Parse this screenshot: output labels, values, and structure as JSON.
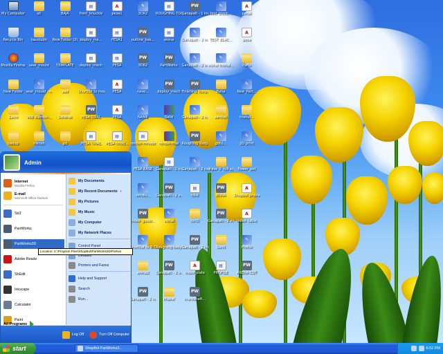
{
  "desktop": {
    "icons": [
      {
        "label": "My Computer",
        "kind": "pc",
        "glyph": ""
      },
      {
        "label": "stl",
        "kind": "folder",
        "glyph": ""
      },
      {
        "label": "BAJA",
        "kind": "folder",
        "glyph": ""
      },
      {
        "label": "front_knuckle",
        "kind": "doc",
        "glyph": "▤"
      },
      {
        "label": "pesa1",
        "kind": "pdf",
        "glyph": "A"
      },
      {
        "label": "3DR2",
        "kind": "app",
        "glyph": "✎"
      },
      {
        "label": "ROUGHING TOOLPAT...",
        "kind": "doc",
        "glyph": "▤"
      },
      {
        "label": "Ganapati - 1 inch - Top - 7",
        "kind": "pw",
        "glyph": "PW"
      },
      {
        "label": "test_block...",
        "kind": "app",
        "glyph": "✎"
      },
      {
        "label": "pesal",
        "kind": "pdf",
        "glyph": "A"
      },
      {
        "label": "Recycle Bin",
        "kind": "bin",
        "glyph": ""
      },
      {
        "label": "kaustubh",
        "kind": "folder",
        "glyph": ""
      },
      {
        "label": "New Folder (2)",
        "kind": "folder",
        "glyph": ""
      },
      {
        "label": "deploy_me...",
        "kind": "doc",
        "glyph": "▤"
      },
      {
        "label": "PESA1",
        "kind": "doc",
        "glyph": "▤"
      },
      {
        "label": "outline_bas...",
        "kind": "pw",
        "glyph": "PW"
      },
      {
        "label": "arena",
        "kind": "doc",
        "glyph": "▤"
      },
      {
        "label": "Ganapati - 2 inch - Top - 5",
        "kind": "app",
        "glyph": "✎"
      },
      {
        "label": "TEST_BLAC...",
        "kind": "app",
        "glyph": "✎"
      },
      {
        "label": "pesa",
        "kind": "pdf",
        "glyph": "A"
      },
      {
        "label": "Mozilla Firefox",
        "kind": "ff",
        "glyph": ""
      },
      {
        "label": "seat_mould",
        "kind": "folder",
        "glyph": ""
      },
      {
        "label": "TEMPLATE",
        "kind": "folder",
        "glyph": ""
      },
      {
        "label": "deploy_mech",
        "kind": "doc",
        "glyph": "▤"
      },
      {
        "label": "PESA",
        "kind": "doc",
        "glyph": "▤"
      },
      {
        "label": "3DR2",
        "kind": "pw",
        "glyph": "PW"
      },
      {
        "label": "PartWorks",
        "kind": "pw",
        "glyph": "PW"
      },
      {
        "label": "Ganapati - 2 inch - Top - 8",
        "kind": "app",
        "glyph": "✎"
      },
      {
        "label": "vishal trishul...",
        "kind": "app",
        "glyph": "✎"
      },
      {
        "label": "Parts",
        "kind": "folder",
        "glyph": ""
      },
      {
        "label": "New Folder",
        "kind": "folder",
        "glyph": ""
      },
      {
        "label": "seat_mould - new",
        "kind": "app",
        "glyph": "✎"
      },
      {
        "label": "aad",
        "kind": "folder",
        "glyph": ""
      },
      {
        "label": "Shortcut to moodcutting",
        "kind": "app",
        "glyph": "✎"
      },
      {
        "label": "PESA",
        "kind": "pdf",
        "glyph": "A"
      },
      {
        "label": "nave...",
        "kind": "app",
        "glyph": "✎"
      },
      {
        "label": "deploy_mech",
        "kind": "pw",
        "glyph": "PW"
      },
      {
        "label": "Finishing Toolpat...",
        "kind": "pw",
        "glyph": "PW"
      },
      {
        "label": "Baha",
        "kind": "folder",
        "glyph": ""
      },
      {
        "label": "New_Part...",
        "kind": "app",
        "glyph": "✎"
      },
      {
        "label": "Sachi",
        "kind": "folder",
        "glyph": ""
      },
      {
        "label": "VAB Warnish...",
        "kind": "folder",
        "glyph": ""
      },
      {
        "label": "Solidrak",
        "kind": "folder",
        "glyph": ""
      },
      {
        "label": "PESA TRIAL",
        "kind": "pw",
        "glyph": "PW"
      },
      {
        "label": "PESA",
        "kind": "pdf",
        "glyph": "A"
      },
      {
        "label": "NAME",
        "kind": "app",
        "glyph": "✎"
      },
      {
        "label": "Solid",
        "kind": "rar",
        "glyph": ""
      },
      {
        "label": "Ganapati - 2 inch32",
        "kind": "app",
        "glyph": "✎"
      },
      {
        "label": "sarchet",
        "kind": "folder",
        "glyph": ""
      },
      {
        "label": "trishul...",
        "kind": "folder",
        "glyph": ""
      },
      {
        "label": "badup",
        "kind": "folder",
        "glyph": ""
      },
      {
        "label": "nikhsh",
        "kind": "folder",
        "glyph": ""
      },
      {
        "label": "pd",
        "kind": "folder",
        "glyph": ""
      },
      {
        "label": "PESA TRIAL",
        "kind": "doc",
        "glyph": "▤"
      },
      {
        "label": "PESA (mod...",
        "kind": "doc",
        "glyph": "▤"
      },
      {
        "label": "render-Hmode",
        "kind": "doc",
        "glyph": "▤"
      },
      {
        "label": "render-final",
        "kind": "rar",
        "glyph": ""
      },
      {
        "label": "Roughing Toolpath...",
        "kind": "pw",
        "glyph": "PW"
      },
      {
        "label": "gotu...",
        "kind": "app",
        "glyph": "✎"
      },
      {
        "label": "3D print",
        "kind": "app",
        "glyph": "✎"
      },
      {
        "label": "PESA BASE",
        "kind": "app",
        "glyph": "✎"
      },
      {
        "label": "Ganapati - 1 inch",
        "kind": "doc",
        "glyph": "▤"
      },
      {
        "label": "Ganapati - 2 inch123",
        "kind": "app",
        "glyph": "✎"
      },
      {
        "label": "drave_6_full scale...",
        "kind": "folder",
        "glyph": ""
      },
      {
        "label": "flower_pot",
        "kind": "folder",
        "glyph": ""
      },
      {
        "label": "zendis...",
        "kind": "app",
        "glyph": "✎"
      },
      {
        "label": "Ganapati - 2 inch - Top - 2",
        "kind": "pw",
        "glyph": "PW"
      },
      {
        "label": "tdlst",
        "kind": "doc",
        "glyph": "▤"
      },
      {
        "label": "BDNA",
        "kind": "pw",
        "glyph": "PW"
      },
      {
        "label": "Shopbot problem",
        "kind": "pdf",
        "glyph": "A"
      },
      {
        "label": "index_guide...",
        "kind": "pw",
        "glyph": "PW"
      },
      {
        "label": "vishal",
        "kind": "app",
        "glyph": "✎"
      },
      {
        "label": "fort0",
        "kind": "folder",
        "glyph": ""
      },
      {
        "label": "Ganapati - 2 inch - Top - 3",
        "kind": "pw",
        "glyph": "PW"
      },
      {
        "label": "index_table",
        "kind": "pdf",
        "glyph": "A"
      },
      {
        "label": "Shortcut to B-TECH...",
        "kind": "app",
        "glyph": "✎"
      },
      {
        "label": "Roughing toolpath - Top",
        "kind": "app",
        "glyph": "✎"
      },
      {
        "label": "Ganapati - 2 inch - Top - 4",
        "kind": "pw",
        "glyph": "PW"
      },
      {
        "label": "Sunit",
        "kind": "folder",
        "glyph": ""
      },
      {
        "label": "Profile",
        "kind": "app",
        "glyph": "✎"
      },
      {
        "label": "arena2",
        "kind": "folder",
        "glyph": ""
      },
      {
        "label": "Ganapati - 2 inch - Top - 5",
        "kind": "pw",
        "glyph": "PW"
      },
      {
        "label": "index_plate",
        "kind": "pdf",
        "glyph": "A"
      },
      {
        "label": "PROFILE",
        "kind": "doc",
        "glyph": "▤"
      },
      {
        "label": "ARENA CUT",
        "kind": "pw",
        "glyph": "PW"
      },
      {
        "label": "Ganapati - 2 inch - Top - 6",
        "kind": "pw",
        "glyph": "PW"
      },
      {
        "label": "khakal",
        "kind": "folder",
        "glyph": ""
      },
      {
        "label": "crankshaft...",
        "kind": "pw",
        "glyph": "PW"
      }
    ]
  },
  "start_menu": {
    "user_name": "Admin",
    "pinned": [
      {
        "title": "Internet",
        "subtitle": "Mozilla Firefox",
        "icon": "firefox-icon",
        "color": "#e0601a"
      },
      {
        "title": "E-mail",
        "subtitle": "Microsoft Office Outlook",
        "icon": "outlook-icon",
        "color": "#f0b21c"
      }
    ],
    "recent": [
      {
        "title": "Sb3",
        "icon": "shopbot-icon",
        "color": "#3a6cc9"
      },
      {
        "title": "PartWorks",
        "icon": "partworks-icon",
        "color": "#4b5b70"
      },
      {
        "title": "PartWorks3D",
        "icon": "partworks3d-icon",
        "color": "#4b5b70"
      },
      {
        "title": "Adobe Reade",
        "icon": "adobe-reader-icon",
        "color": "#cc1414"
      },
      {
        "title": "ShEdit",
        "icon": "shedit-icon",
        "color": "#3a6cc9"
      },
      {
        "title": "Inkscape",
        "icon": "inkscape-icon",
        "color": "#333333"
      },
      {
        "title": "Calculator",
        "icon": "calculator-icon",
        "color": "#6b7d95"
      },
      {
        "title": "Paint",
        "icon": "paint-icon",
        "color": "#d9a118"
      }
    ],
    "all_programs": "All Programs",
    "right": [
      {
        "title": "My Documents",
        "bold": true,
        "color": "#f2c744"
      },
      {
        "title": "My Recent Documents",
        "bold": true,
        "color": "#f2c744",
        "arrow": "›"
      },
      {
        "title": "My Pictures",
        "bold": true,
        "color": "#f2c744"
      },
      {
        "title": "My Music",
        "bold": true,
        "color": "#f2c744"
      },
      {
        "title": "My Computer",
        "bold": true,
        "color": "#8bb0e0"
      },
      {
        "title": "My Network Places",
        "bold": true,
        "color": "#8bb0e0"
      },
      {
        "title": "Control Panel",
        "bold": false,
        "color": "#7aa5d8"
      },
      {
        "title": "Defaults",
        "bold": false,
        "color": "#7aa5d8"
      },
      {
        "title": "Printers and Faxes",
        "bold": false,
        "color": "#8a8a8a"
      },
      {
        "title": "Help and Support",
        "bold": false,
        "color": "#2f6ed1"
      },
      {
        "title": "Search",
        "bold": false,
        "color": "#8a8a8a"
      },
      {
        "title": "Run...",
        "bold": false,
        "color": "#8a8a8a"
      }
    ],
    "logoff_label": "Log Off",
    "turnoff_label": "Turn Off Computer"
  },
  "tooltip": {
    "text": "Location: C:\\Program Files\\ShopBot\\PartWorks3D\\Partwo"
  },
  "taskbar": {
    "start_label": "start",
    "task_label": "ShopBot PartWorks3...",
    "clock": "6:52 PM"
  },
  "colors": {
    "taskbar": "#245edb",
    "start_green": "#3c9a3c",
    "highlight": "#316ac5"
  }
}
